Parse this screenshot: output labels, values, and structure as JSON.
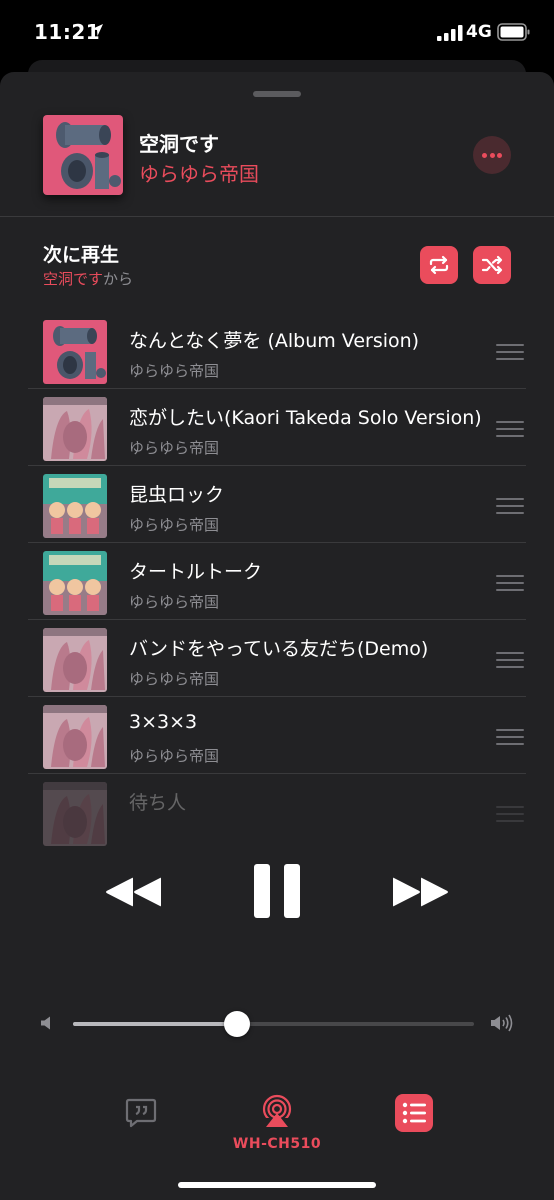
{
  "status_bar": {
    "time": "11:21",
    "network": "4G",
    "icons": [
      "location-arrow-icon",
      "signal-bars-icon",
      "battery-icon"
    ]
  },
  "now_playing": {
    "title": "空洞です",
    "artist": "ゆらゆら帝国",
    "more_icon": "more-dots-icon"
  },
  "up_next": {
    "title": "次に再生",
    "source_name": "空洞です",
    "source_suffix": "から",
    "repeat_icon": "repeat-icon",
    "shuffle_icon": "shuffle-icon"
  },
  "queue": [
    {
      "title": "なんとなく夢を (Album Version)",
      "artist": "ゆらゆら帝国",
      "art": "kudou"
    },
    {
      "title": "恋がしたい(Kaori Takeda Solo Version)",
      "artist": "ゆらゆら帝国",
      "art": "pink"
    },
    {
      "title": "昆虫ロック",
      "artist": "ゆらゆら帝国",
      "art": "teal"
    },
    {
      "title": "タートルトーク",
      "artist": "ゆらゆら帝国",
      "art": "teal"
    },
    {
      "title": "バンドをやっている友だち(Demo)",
      "artist": "ゆらゆら帝国",
      "art": "pink"
    },
    {
      "title": "3×3×3",
      "artist": "ゆらゆら帝国",
      "art": "pink"
    },
    {
      "title": "待ち人",
      "artist": "",
      "art": "pink"
    }
  ],
  "playback": {
    "state": "playing",
    "icons": [
      "rewind-icon",
      "pause-icon",
      "fast-forward-icon"
    ]
  },
  "volume": {
    "level": 0.41
  },
  "bottom_bar": {
    "device_name": "WH-CH510",
    "icons": [
      "lyrics-icon",
      "airplay-icon",
      "queue-list-icon"
    ]
  },
  "colors": {
    "accent": "#ea4c5c",
    "sheet_background": "#222224",
    "secondary_text": "#8e8e93"
  }
}
